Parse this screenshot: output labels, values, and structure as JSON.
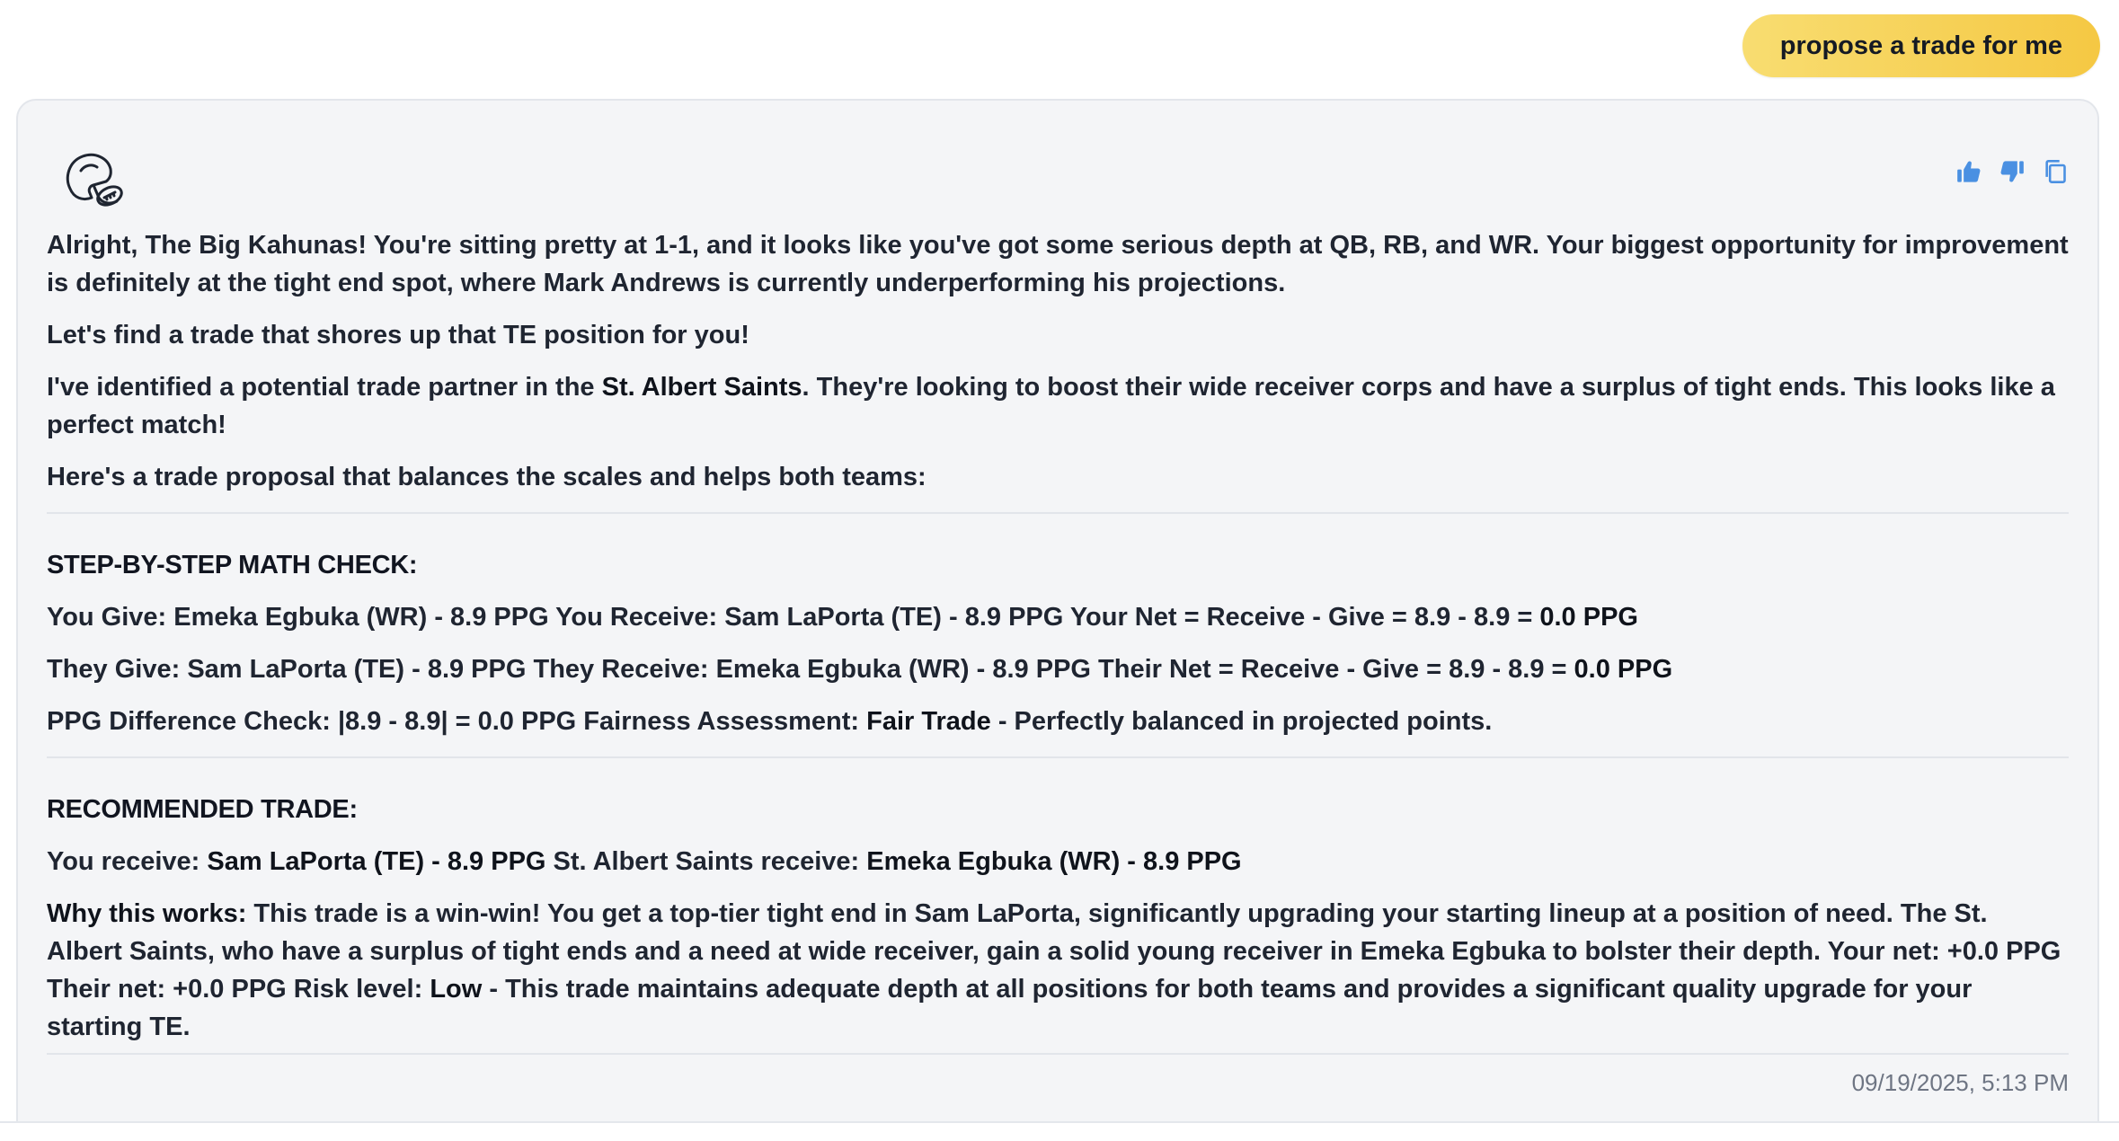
{
  "user_message": "propose a trade for me",
  "colors": {
    "bubble_start": "#f8dd71",
    "bubble_end": "#f5c843",
    "icon_blue": "#4a90e2",
    "card_bg": "#f4f5f7"
  },
  "icons": {
    "avatar": "football-helmet-icon",
    "like": "thumbs-up-icon",
    "dislike": "thumbs-down-icon",
    "copy": "copy-icon"
  },
  "response": {
    "intro": "Alright, The Big Kahunas! You're sitting pretty at 1-1, and it looks like you've got some serious depth at QB, RB, and WR. Your biggest opportunity for improvement is definitely at the tight end spot, where Mark Andrews is currently underperforming his projections.",
    "lets_find": "Let's find a trade that shores up that TE position for you!",
    "partner_pre": "I've identified a potential trade partner in the ",
    "partner_name": "St. Albert Saints",
    "partner_post": ". They're looking to boost their wide receiver corps and have a surplus of tight ends. This looks like a perfect match!",
    "proposal_lead": "Here's a trade proposal that balances the scales and helps both teams:",
    "math_heading": "STEP-BY-STEP MATH CHECK:",
    "you_give_text": "You Give: Emeka Egbuka (WR) - 8.9 PPG You Receive: Sam LaPorta (TE) - 8.9 PPG Your Net = Receive - Give = 8.9 - 8.9 = ",
    "you_give_net": "0.0 PPG",
    "they_give_text": "They Give: Sam LaPorta (TE) - 8.9 PPG They Receive: Emeka Egbuka (WR) - 8.9 PPG Their Net = Receive - Give = 8.9 - 8.9 = ",
    "they_give_net": "0.0 PPG",
    "diff_text": "PPG Difference Check: |8.9 - 8.9| = 0.0 PPG Fairness Assessment: ",
    "diff_verdict": "Fair Trade",
    "diff_post": " - Perfectly balanced in projected points.",
    "rec_heading": "RECOMMENDED TRADE:",
    "rec_you_receive_label": "You receive: ",
    "rec_you_receive_value": "Sam LaPorta (TE) - 8.9 PPG",
    "rec_they_receive_label": " St. Albert Saints receive: ",
    "rec_they_receive_value": "Emeka Egbuka (WR) - 8.9 PPG",
    "why_label": "Why this works:",
    "why_text": " This trade is a win-win! You get a top-tier tight end in Sam LaPorta, significantly upgrading your starting lineup at a position of need. The St. Albert Saints, who have a surplus of tight ends and a need at wide receiver, gain a solid young receiver in Emeka Egbuka to bolster their depth. Your net: +0.0 PPG Their net: +0.0 PPG Risk level: ",
    "risk_level": "Low",
    "why_post": " - This trade maintains adequate depth at all positions for both teams and provides a significant quality upgrade for your starting TE."
  },
  "timestamp": "09/19/2025, 5:13 PM"
}
